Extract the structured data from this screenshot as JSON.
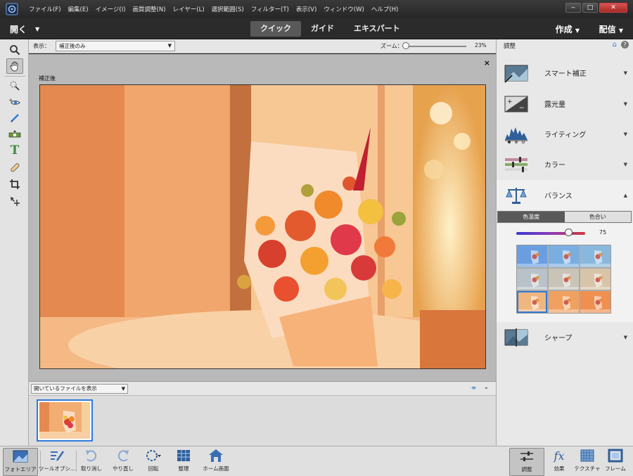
{
  "menubar": {
    "items": [
      "ファイル(F)",
      "編集(E)",
      "イメージ(I)",
      "画質調整(N)",
      "レイヤー(L)",
      "選択範囲(S)",
      "フィルター(T)",
      "表示(V)",
      "ウィンドウ(W)",
      "ヘルプ(H)"
    ],
    "window_controls": [
      "minimize",
      "maximize",
      "close"
    ]
  },
  "modebar": {
    "open_label": "開く",
    "tabs": [
      "クイック",
      "ガイド",
      "エキスパート"
    ],
    "active_tab": "クイック",
    "create_label": "作成",
    "share_label": "配信"
  },
  "options": {
    "view_label": "表示：",
    "view_value": "補正後のみ",
    "zoom_label": "ズーム：",
    "zoom_value": "23%",
    "zoom_fraction": 0.02
  },
  "canvas": {
    "view_caption": "補正後",
    "close_symbol": "×"
  },
  "film": {
    "select_value": "開いているファイルを表示"
  },
  "adjustments": {
    "title": "調整",
    "items": [
      {
        "label": "スマート補正",
        "icon": "smart-fix-icon",
        "expanded": false
      },
      {
        "label": "露光量",
        "icon": "exposure-icon",
        "expanded": false
      },
      {
        "label": "ライティング",
        "icon": "lighting-icon",
        "expanded": false
      },
      {
        "label": "カラー",
        "icon": "color-icon",
        "expanded": false
      },
      {
        "label": "バランス",
        "icon": "balance-icon",
        "expanded": true
      },
      {
        "label": "シャープ",
        "icon": "sharpen-icon",
        "expanded": false
      }
    ],
    "balance": {
      "tabs": [
        "色温度",
        "色合い"
      ],
      "active_tab": "色温度",
      "temperature_value": "75",
      "temperature_fraction": 0.75,
      "selected_preset": 6
    }
  },
  "bottombar": {
    "left": [
      "フォトエリア",
      "ツールオプシ...",
      "取り消し",
      "やり直し",
      "回転",
      "整理",
      "ホーム画面"
    ],
    "right": [
      "調整",
      "効果",
      "テクスチャ",
      "フレーム"
    ],
    "active": "調整"
  },
  "colors": {
    "accent": "#2f7ad8",
    "photo_warm": "#f0a060",
    "chrome_dark": "#2b2b2b"
  }
}
